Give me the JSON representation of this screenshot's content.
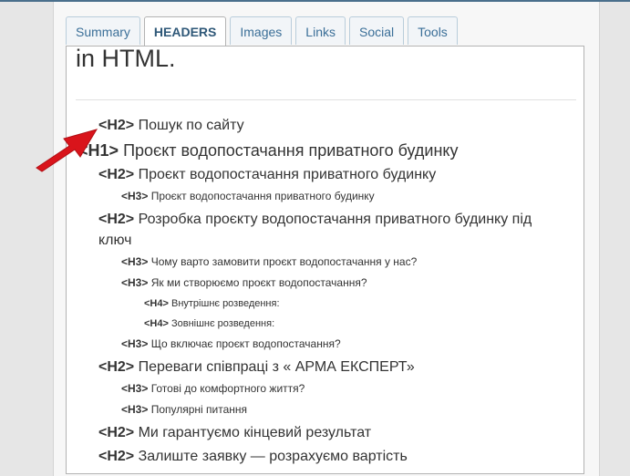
{
  "tabs": [
    {
      "label": "Summary",
      "active": false
    },
    {
      "label": "Headers",
      "active": true
    },
    {
      "label": "Images",
      "active": false
    },
    {
      "label": "Links",
      "active": false
    },
    {
      "label": "Social",
      "active": false
    },
    {
      "label": "Tools",
      "active": false
    }
  ],
  "page_heading": "in HTML.",
  "headers": [
    {
      "tag": "<H2>",
      "text": "Пошук по сайту"
    },
    {
      "tag": "<H1>",
      "text": "Проєкт водопостачання приватного будинку"
    },
    {
      "tag": "<H2>",
      "text": "Проєкт водопостачання приватного будинку"
    },
    {
      "tag": "<H3>",
      "text": "Проєкт водопостачання приватного будинку"
    },
    {
      "tag": "<H2>",
      "text": "Розробка проєкту водопостачання приватного будинку під ключ"
    },
    {
      "tag": "<H3>",
      "text": "Чому варто замовити проєкт водопостачання у нас?"
    },
    {
      "tag": "<H3>",
      "text": "Як ми створюємо проєкт водопостачання?"
    },
    {
      "tag": "<H4>",
      "text": "Внутрішнє розведення:"
    },
    {
      "tag": "<H4>",
      "text": "Зовнішнє розведення:"
    },
    {
      "tag": "<H3>",
      "text": "Що включає проєкт водопостачання?"
    },
    {
      "tag": "<H2>",
      "text": "Переваги співпраці з « АРМА ЕКСПЕРТ»"
    },
    {
      "tag": "<H3>",
      "text": "Готові до комфортного життя?"
    },
    {
      "tag": "<H3>",
      "text": "Популярні питання"
    },
    {
      "tag": "<H2>",
      "text": "Ми гарантуємо кінцевий результат"
    },
    {
      "tag": "<H2>",
      "text": "Залиште заявку — розрахуємо вартість"
    }
  ],
  "colors": {
    "accent": "#3b6f98",
    "arrow": "#d9141b",
    "top_bar": "#4a6f8c"
  }
}
